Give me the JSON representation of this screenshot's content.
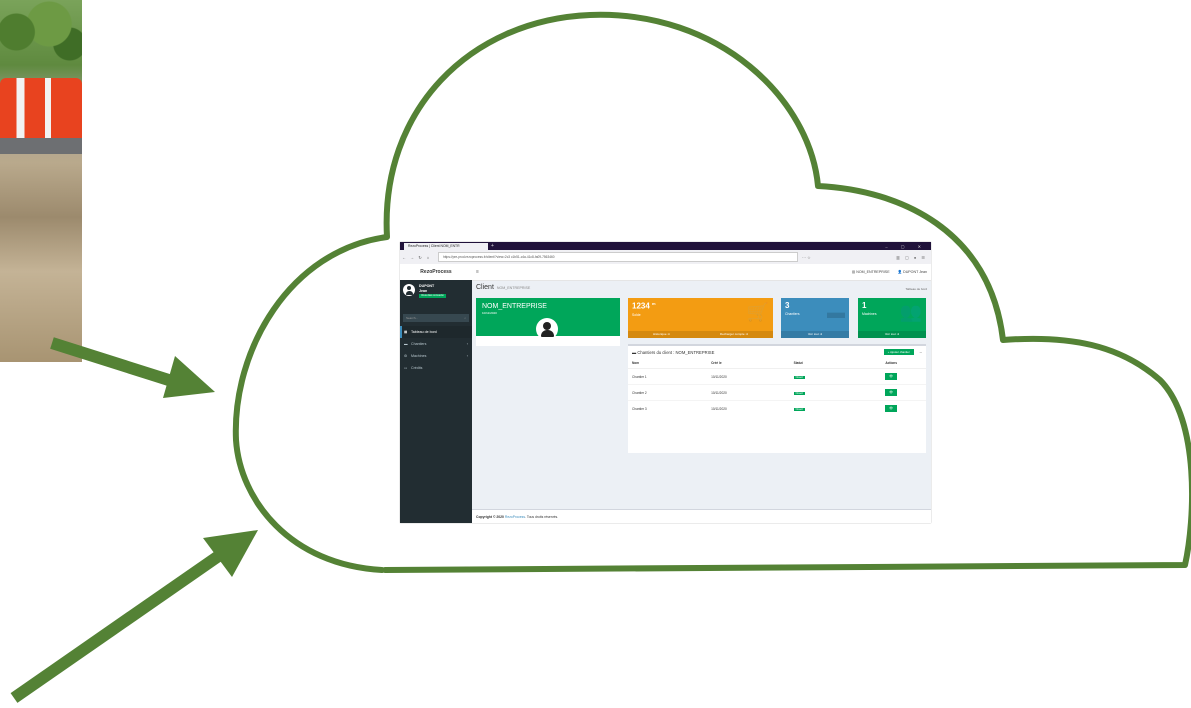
{
  "colors": {
    "cloud_green": "#548235",
    "arrow_green": "#548235",
    "header_dark": "#20123a",
    "sidebar": "#222d32",
    "success": "#00a65a",
    "warning": "#f39c12",
    "info": "#3c8dbc"
  },
  "browser": {
    "tab_title": "RezoProcess | Client NOM_ENTR",
    "url": "https://pre-prod.rezoprocess.fr/client/?view=2c3 c1b51-c4a-41c8-fa09-7563460"
  },
  "app": {
    "brand": "RezoProcess",
    "header_company": "NOM_ENTREPRISE",
    "header_user": "DUPONT Jean"
  },
  "sidebar": {
    "user_lastname": "DUPONT",
    "user_firstname": "Jean",
    "user_status": "Vous êtes connecté",
    "search_placeholder": "Search...",
    "items": [
      {
        "icon": "dashboard-icon",
        "label": "Tableau de bord"
      },
      {
        "icon": "briefcase-icon",
        "label": "Chantiers"
      },
      {
        "icon": "tools-icon",
        "label": "Machines"
      },
      {
        "icon": "credit-card-icon",
        "label": "Crédits"
      }
    ]
  },
  "page": {
    "title": "Client",
    "subtitle": "NOM_ENTREPRISE",
    "breadcrumb": "Tableau de bord"
  },
  "client_card": {
    "name": "NOM_ENTREPRISE",
    "date": "10/11/2020"
  },
  "stats": {
    "solde": {
      "value": "1234",
      "unit": "m",
      "label": "Solde",
      "link1": "Historique",
      "link2": "Recharger compte"
    },
    "chantiers": {
      "value": "3",
      "label": "Chantiers",
      "link": "Voir tout"
    },
    "machines": {
      "value": "1",
      "label": "Machines",
      "link": "Voir tout"
    }
  },
  "chantiers_table": {
    "title": "Chantiers du client : NOM_ENTREPRISE",
    "add_label": "Ajouter chantier",
    "headers": [
      "Nom",
      "Créé le",
      "Statut",
      "Actions"
    ],
    "rows": [
      {
        "nom": "Chantier 1",
        "date": "10/11/2020",
        "statut": "Ouvert"
      },
      {
        "nom": "Chantier 2",
        "date": "10/11/2020",
        "statut": "Ouvert"
      },
      {
        "nom": "Chantier 3",
        "date": "10/11/2020",
        "statut": "Ouvert"
      }
    ]
  },
  "footer": {
    "prefix": "Copyright © 2020 ",
    "brand": "RezoProcess",
    "suffix": ". Tous droits réservés."
  }
}
